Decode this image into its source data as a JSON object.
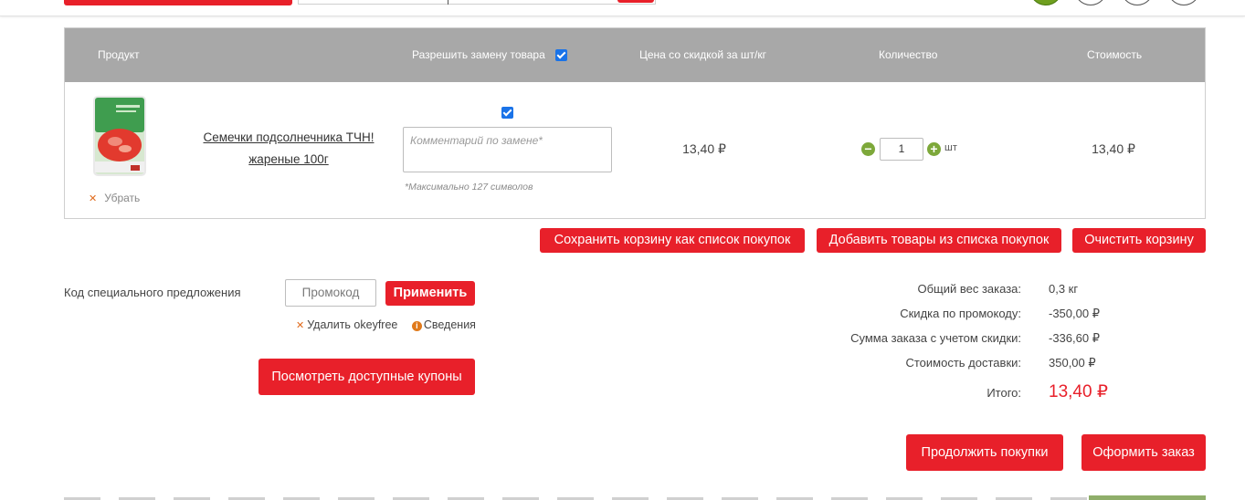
{
  "header": {
    "columns": {
      "product": "Продукт",
      "allow_replace": "Разрешить замену товара",
      "price": "Цена со скидкой за шт/кг",
      "quantity": "Количество",
      "cost": "Стоимость"
    }
  },
  "cart_item": {
    "name": "Семечки подсолнечника ТЧН! жареные 100г",
    "remove_label": "Убрать",
    "comment_placeholder": "Комментарий по замене*",
    "comment_hint": "*Максимально 127 символов",
    "price": "13,40 ₽",
    "quantity": "1",
    "unit": "шт",
    "cost": "13,40 ₽",
    "allow_replace": true
  },
  "actions": {
    "save_list": "Сохранить корзину как список покупок",
    "add_from_list": "Добавить товары из списка покупок",
    "clear_cart": "Очистить корзину"
  },
  "promo": {
    "label": "Код специального предложения",
    "placeholder": "Промокод",
    "apply": "Применить",
    "remove_code": "Удалить okeyfree",
    "details": "Сведения",
    "view_coupons": "Посмотреть доступные купоны"
  },
  "summary": {
    "weight_label": "Общий вес заказа:",
    "weight_value": "0,3 кг",
    "discount_label": "Скидка по промокоду:",
    "discount_value": "-350,00 ₽",
    "sum_label": "Сумма заказа с учетом скидки:",
    "sum_value": "-336,60 ₽",
    "delivery_label": "Стоимость доставки:",
    "delivery_value": "350,00 ₽",
    "total_label": "Итого:",
    "total_value": "13,40 ₽"
  },
  "footer": {
    "continue": "Продолжить покупки",
    "checkout": "Оформить заказ"
  },
  "colors": {
    "accent": "#e8202a",
    "header_bg": "#a8a8a8",
    "qty_button": "#7da83a"
  }
}
